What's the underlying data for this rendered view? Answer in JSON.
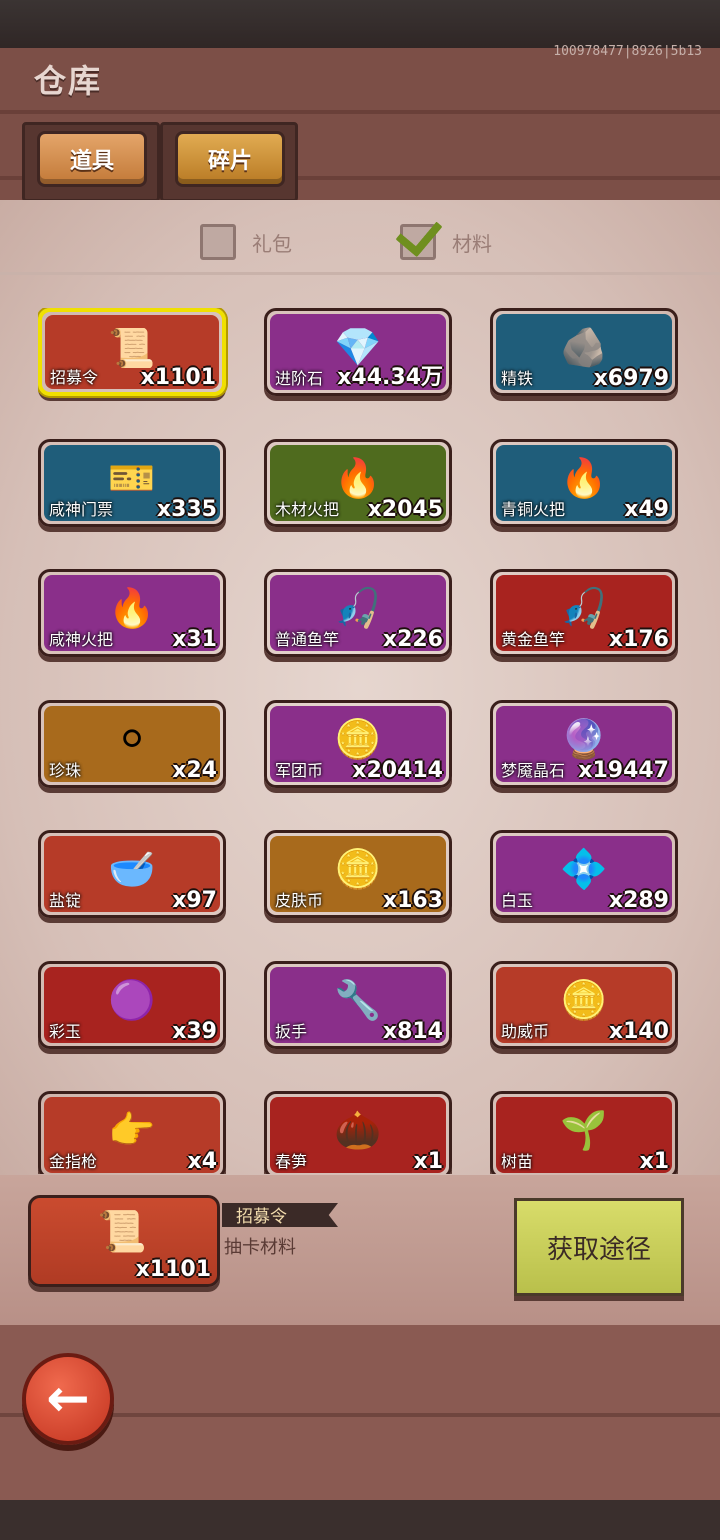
{
  "header": {
    "title": "仓库",
    "server_info": "100978477|8926|5b13",
    "tabs": [
      {
        "label": "道具",
        "active": true
      },
      {
        "label": "碎片",
        "active": false
      }
    ]
  },
  "filters": [
    {
      "label": "礼包",
      "checked": false
    },
    {
      "label": "材料",
      "checked": true
    }
  ],
  "items": [
    {
      "name": "招募令",
      "qty": "x1101",
      "bg": "#b63b28",
      "icon": "📜",
      "selected": true
    },
    {
      "name": "进阶石",
      "qty": "x44.34万",
      "bg": "#8a2f8a",
      "icon": "💎"
    },
    {
      "name": "精铁",
      "qty": "x6979",
      "bg": "#1f5d7a",
      "icon": "🪨"
    },
    {
      "name": "咸神门票",
      "qty": "x335",
      "bg": "#1f5d7a",
      "icon": "🎫"
    },
    {
      "name": "木材火把",
      "qty": "x2045",
      "bg": "#4f6b1e",
      "icon": "🔥"
    },
    {
      "name": "青铜火把",
      "qty": "x49",
      "bg": "#1f5d7a",
      "icon": "🔥"
    },
    {
      "name": "咸神火把",
      "qty": "x31",
      "bg": "#8a2f8a",
      "icon": "🔥"
    },
    {
      "name": "普通鱼竿",
      "qty": "x226",
      "bg": "#8a2f8a",
      "icon": "🎣"
    },
    {
      "name": "黄金鱼竿",
      "qty": "x176",
      "bg": "#a8231f",
      "icon": "🎣"
    },
    {
      "name": "珍珠",
      "qty": "x24",
      "bg": "#a86a1c",
      "icon": "⚪"
    },
    {
      "name": "军团币",
      "qty": "x20414",
      "bg": "#8a2f8a",
      "icon": "🪙"
    },
    {
      "name": "梦魇晶石",
      "qty": "x19447",
      "bg": "#8a2f8a",
      "icon": "🔮"
    },
    {
      "name": "盐锭",
      "qty": "x97",
      "bg": "#b63b28",
      "icon": "🥣"
    },
    {
      "name": "皮肤币",
      "qty": "x163",
      "bg": "#a86a1c",
      "icon": "🪙"
    },
    {
      "name": "白玉",
      "qty": "x289",
      "bg": "#8a2f8a",
      "icon": "💠"
    },
    {
      "name": "彩玉",
      "qty": "x39",
      "bg": "#a8231f",
      "icon": "🟣"
    },
    {
      "name": "扳手",
      "qty": "x814",
      "bg": "#8a2f8a",
      "icon": "🔧"
    },
    {
      "name": "助威币",
      "qty": "x140",
      "bg": "#b63b28",
      "icon": "🪙"
    },
    {
      "name": "金指枪",
      "qty": "x4",
      "bg": "#b63b28",
      "icon": "👉"
    },
    {
      "name": "春笋",
      "qty": "x1",
      "bg": "#a8231f",
      "icon": "🌰"
    },
    {
      "name": "树苗",
      "qty": "x1",
      "bg": "#a8231f",
      "icon": "🌱"
    }
  ],
  "detail": {
    "name": "招募令",
    "description": "抽卡材料",
    "qty": "x1101",
    "icon": "📜"
  },
  "buttons": {
    "obtain": "获取途径",
    "back": "←"
  }
}
